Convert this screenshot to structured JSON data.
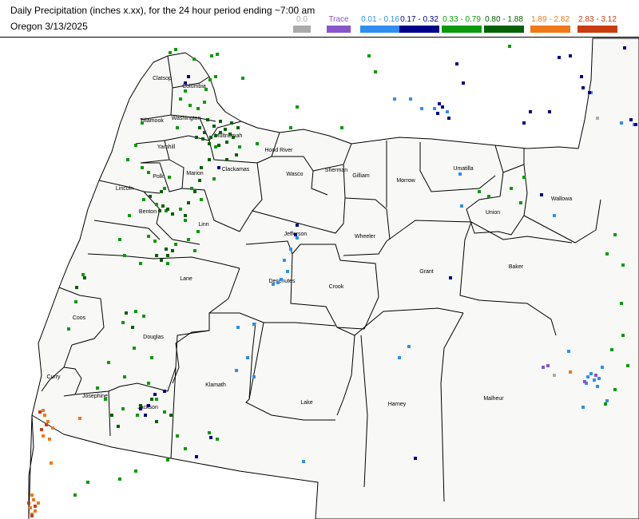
{
  "header": {
    "title": "Daily Precipitation (inches  x.xx),  for the 24 hour period ending ~7:00 am",
    "subtitle": "Oregon 3/13/2025"
  },
  "legend": [
    {
      "label": "0.0",
      "color": "#aaaaaa"
    },
    {
      "label": "Trace",
      "color": "#8855cc"
    },
    {
      "label": "0.01 - 0.16",
      "color": "#2f8ff0"
    },
    {
      "label": "0.17 - 0.32",
      "color": "#00008b"
    },
    {
      "label": "0.33 - 0.79",
      "color": "#0a9a0a"
    },
    {
      "label": "0.80 - 1.88",
      "color": "#056105"
    },
    {
      "label": "1.89 - 2.82",
      "color": "#f07818"
    },
    {
      "label": "2.83 - 3.12",
      "color": "#c83c10"
    }
  ],
  "counties": [
    "Clatsop",
    "Columbia",
    "Washington",
    "Tillamook",
    "Yamhill",
    "Multnomah",
    "Clackamas",
    "Hood River",
    "Wasco",
    "Sherman",
    "Gilliam",
    "Morrow",
    "Umatilla",
    "Union",
    "Wallowa",
    "Polk",
    "Marion",
    "Lincoln",
    "Benton",
    "Linn",
    "Jefferson",
    "Wheeler",
    "Grant",
    "Baker",
    "Lane",
    "Deschutes",
    "Crook",
    "Coos",
    "Douglas",
    "Curry",
    "Josephine",
    "Jackson",
    "Klamath",
    "Lake",
    "Harney",
    "Malheur"
  ]
}
